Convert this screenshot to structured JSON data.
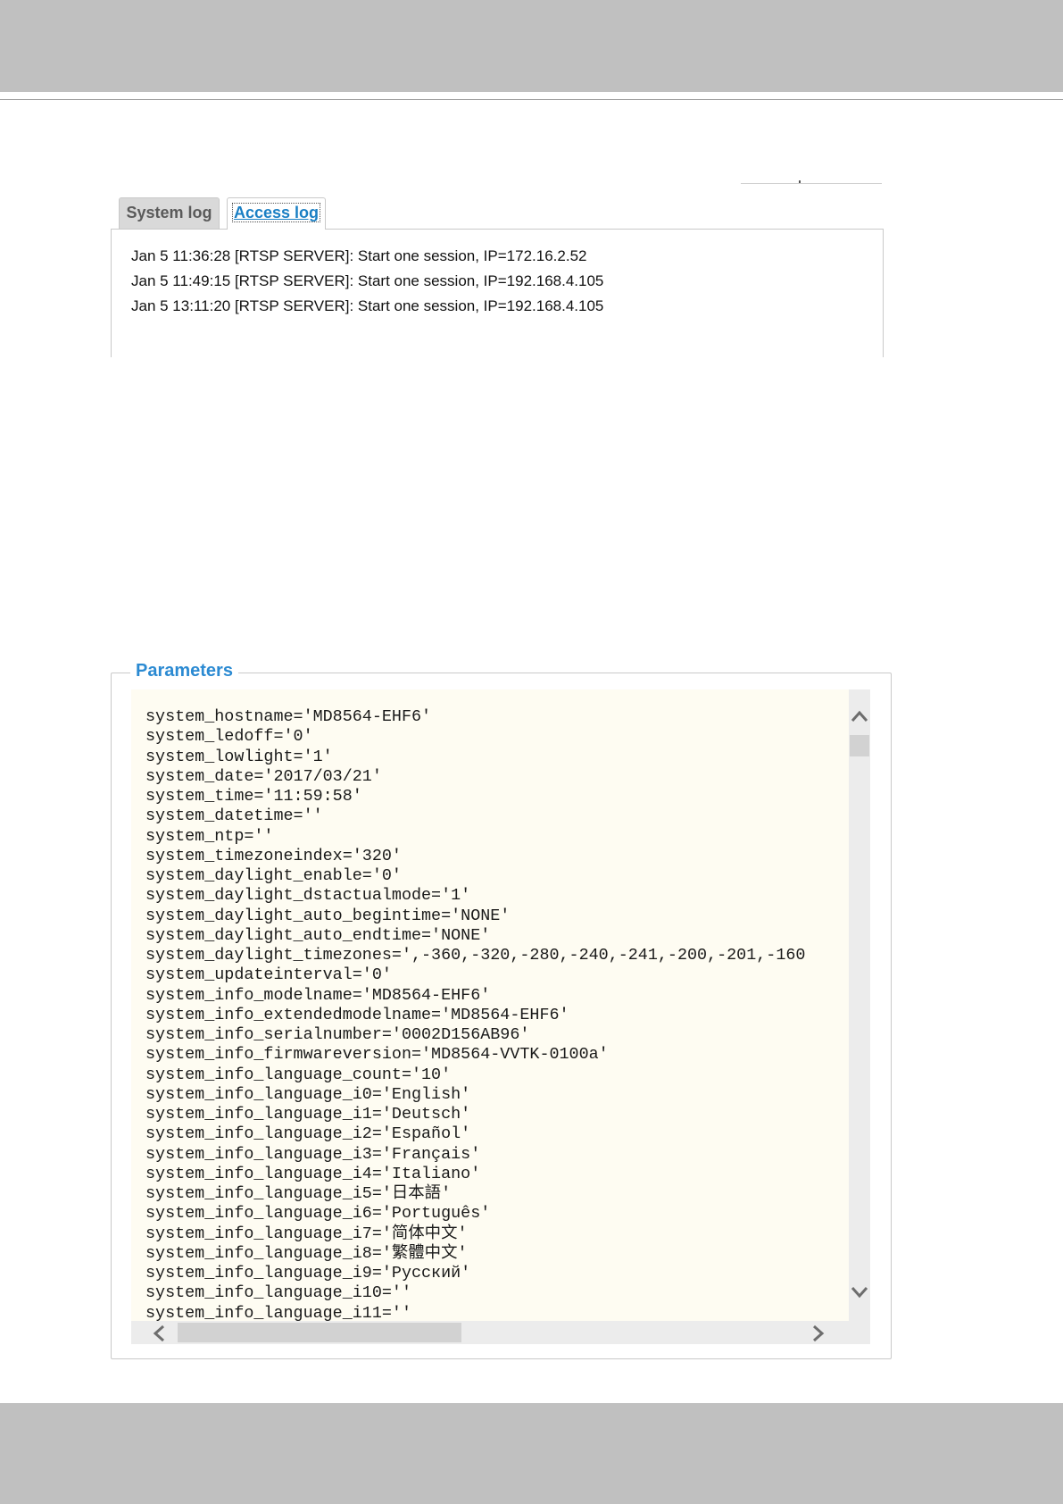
{
  "log_viewer": {
    "tabs": [
      {
        "label": "System log",
        "selected": false
      },
      {
        "label": "Access log",
        "selected": true
      }
    ],
    "entries": [
      "Jan 5 11:36:28 [RTSP SERVER]: Start one session, IP=172.16.2.52",
      "Jan 5 11:49:15 [RTSP SERVER]: Start one session, IP=192.168.4.105",
      "Jan 5 13:11:20 [RTSP SERVER]: Start one session, IP=192.168.4.105"
    ]
  },
  "parameters": {
    "title": "Parameters",
    "lines": [
      "system_hostname='MD8564-EHF6'",
      "system_ledoff='0'",
      "system_lowlight='1'",
      "system_date='2017/03/21'",
      "system_time='11:59:58'",
      "system_datetime=''",
      "system_ntp=''",
      "system_timezoneindex='320'",
      "system_daylight_enable='0'",
      "system_daylight_dstactualmode='1'",
      "system_daylight_auto_begintime='NONE'",
      "system_daylight_auto_endtime='NONE'",
      "system_daylight_timezones=',-360,-320,-280,-240,-241,-200,-201,-160",
      "system_updateinterval='0'",
      "system_info_modelname='MD8564-EHF6'",
      "system_info_extendedmodelname='MD8564-EHF6'",
      "system_info_serialnumber='0002D156AB96'",
      "system_info_firmwareversion='MD8564-VVTK-0100a'",
      "system_info_language_count='10'",
      "system_info_language_i0='English'",
      "system_info_language_i1='Deutsch'",
      "system_info_language_i2='Español'",
      "system_info_language_i3='Français'",
      "system_info_language_i4='Italiano'",
      "system_info_language_i5='日本語'",
      "system_info_language_i6='Português'",
      "system_info_language_i7='简体中文'",
      "system_info_language_i8='繁體中文'",
      "system_info_language_i9='Русский'",
      "system_info_language_i10=''",
      "system_info_language_i11=''"
    ],
    "icons": {
      "scroll_up": "chevron-up-icon",
      "scroll_down": "chevron-down-icon",
      "scroll_left": "chevron-left-icon",
      "scroll_right": "chevron-right-icon"
    }
  },
  "colors": {
    "band_gray": "#c0c0c0",
    "accent_blue": "#2b8ad2",
    "code_background": "#fefcf2"
  }
}
